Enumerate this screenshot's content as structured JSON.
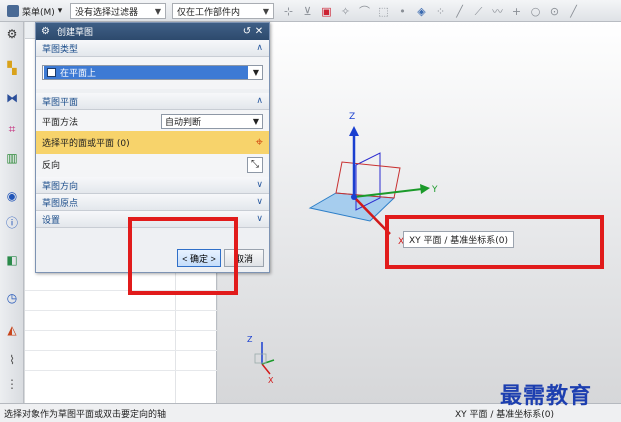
{
  "toolbar": {
    "menu_label": "菜单(M)",
    "filter_select": "没有选择过滤器",
    "scope_select": "仅在工作部件内"
  },
  "dialog": {
    "title": "创建草图",
    "sections": {
      "sketch_type": {
        "header": "草图类型",
        "value": "在平面上"
      },
      "sketch_plane": {
        "header": "草图平面",
        "plane_method_label": "平面方法",
        "plane_method_value": "自动判断",
        "select_face_label": "选择平的面或平面 (0)",
        "reverse_label": "反向"
      },
      "sketch_direction": {
        "header": "草图方向"
      },
      "sketch_origin": {
        "header": "草图原点"
      },
      "settings": {
        "header": "设置"
      }
    },
    "ok_label": "< 确定 >",
    "cancel_label": "取消"
  },
  "viewport": {
    "axis_z": "Z",
    "axis_y": "Y",
    "axis_x": "X",
    "tooltip": "XY 平面 / 基准坐标系(0)",
    "triad_z": "Z",
    "triad_x": "X"
  },
  "status": {
    "left": "选择对象作为草图平面或双击要定向的轴",
    "right": "XY 平面 / 基准坐标系(0)"
  },
  "watermark": "最需教育",
  "colors": {
    "accent_red": "#e11b1b",
    "title_bar": "#2d4a6d",
    "highlight_row": "#f7d36b",
    "selection_blue": "#3d7ad4"
  }
}
